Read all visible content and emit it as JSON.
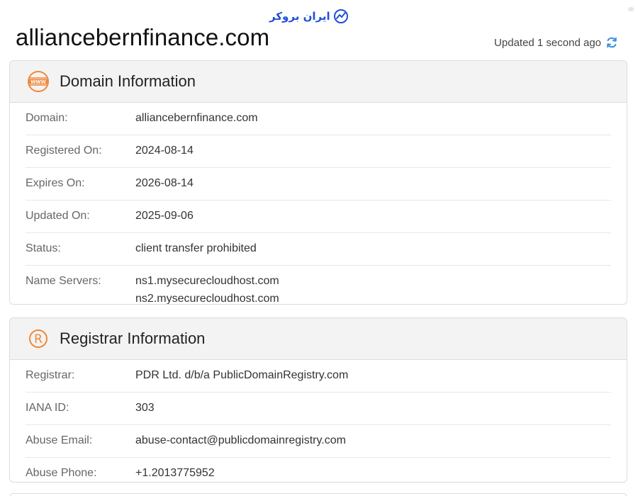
{
  "watermark": {
    "text": "ایران بروکر"
  },
  "page": {
    "title": "alliancebernfinance.com"
  },
  "status_bar": {
    "updated_text": "Updated 1 second ago"
  },
  "domain_info": {
    "header": "Domain Information",
    "icon": "www-globe-icon",
    "rows": [
      {
        "label": "Domain:",
        "value": "alliancebernfinance.com"
      },
      {
        "label": "Registered On:",
        "value": "2024-08-14"
      },
      {
        "label": "Expires On:",
        "value": "2026-08-14"
      },
      {
        "label": "Updated On:",
        "value": "2025-09-06"
      },
      {
        "label": "Status:",
        "value": "client transfer prohibited"
      },
      {
        "label": "Name Servers:",
        "values": [
          "ns1.mysecurecloudhost.com",
          "ns2.mysecurecloudhost.com"
        ]
      }
    ]
  },
  "registrar_info": {
    "header": "Registrar Information",
    "icon": "registered-r-icon",
    "rows": [
      {
        "label": "Registrar:",
        "value": "PDR Ltd. d/b/a PublicDomainRegistry.com"
      },
      {
        "label": "IANA ID:",
        "value": "303"
      },
      {
        "label": "Abuse Email:",
        "value": "abuse-contact@publicdomainregistry.com"
      },
      {
        "label": "Abuse Phone:",
        "value": "+1.2013775952"
      }
    ]
  },
  "colors": {
    "accent_orange": "#f0883e",
    "refresh_blue": "#3b8fe0",
    "watermark_blue": "#1e4fd8"
  }
}
